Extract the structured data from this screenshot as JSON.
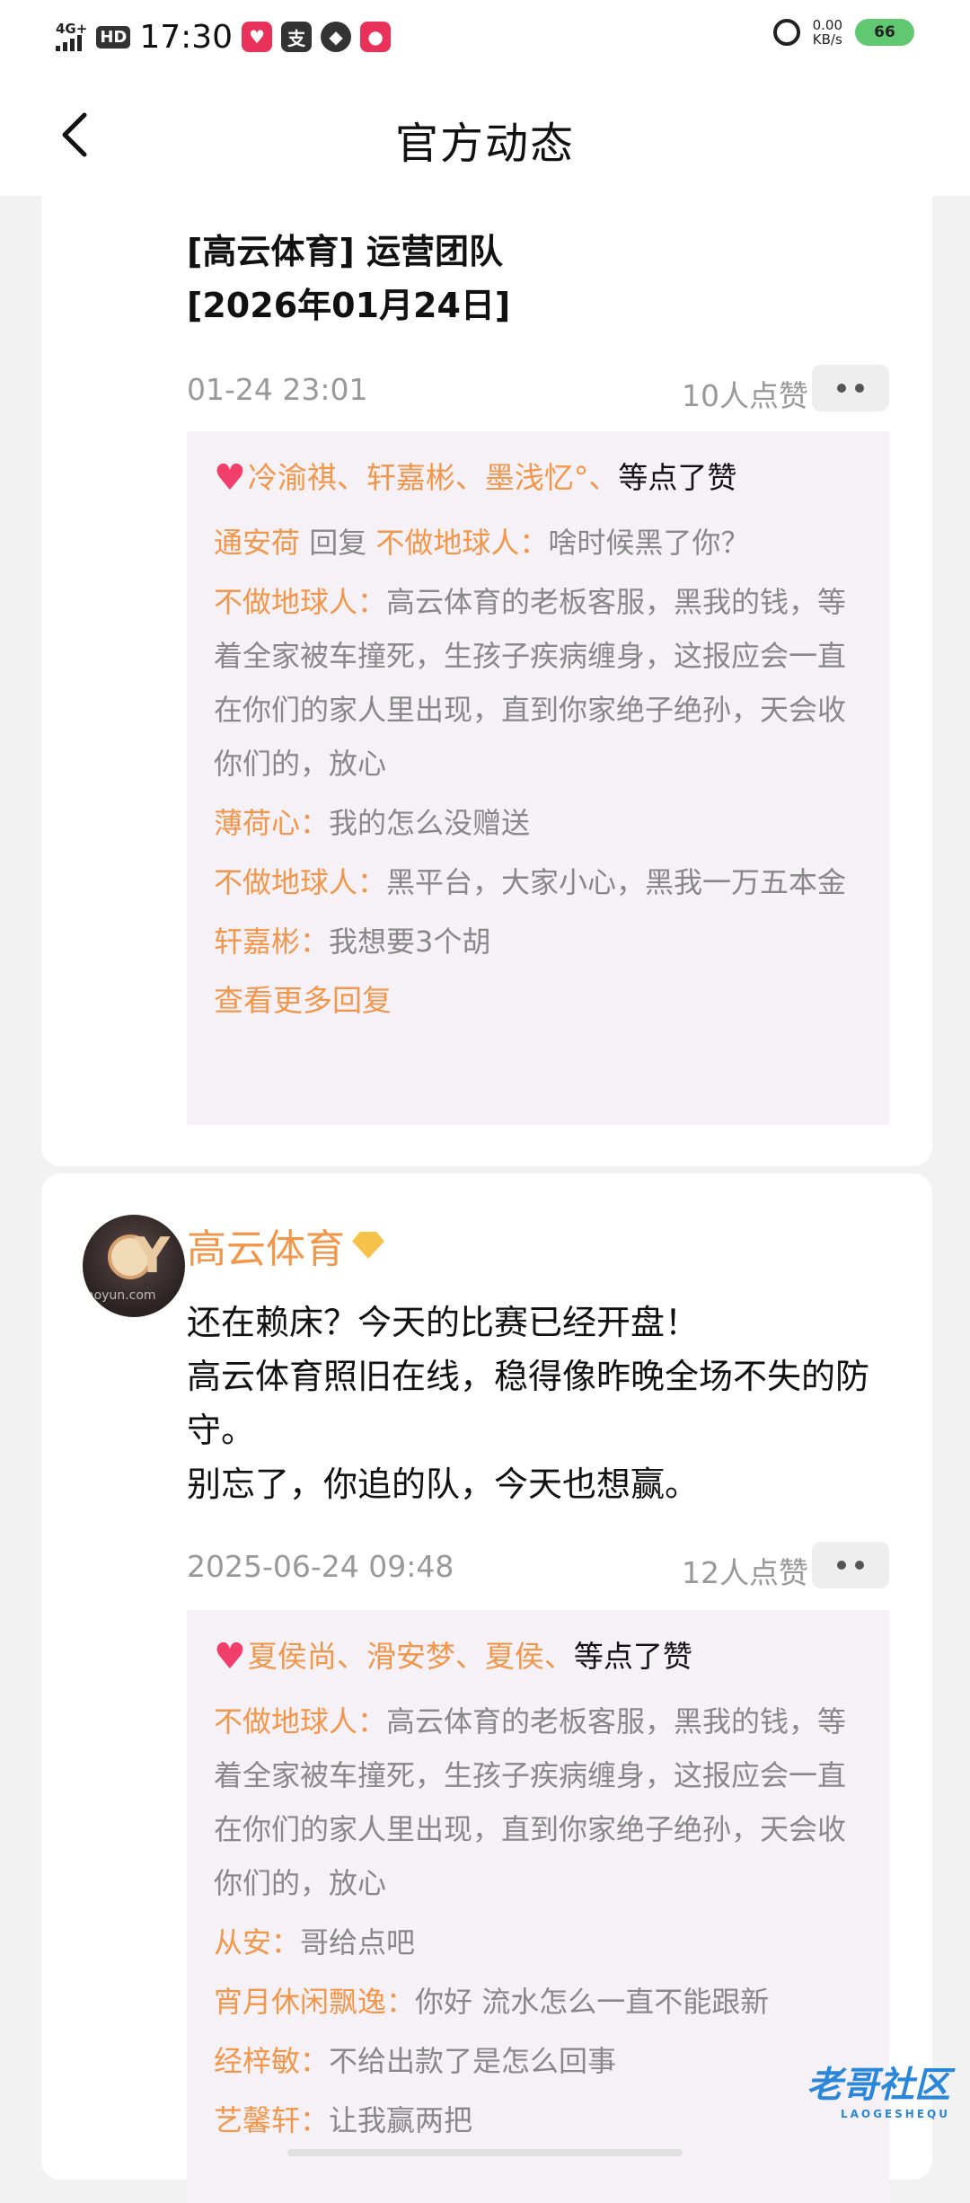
{
  "status_bar": {
    "network": "4G+",
    "hd": "HD",
    "time": "17:30",
    "net_speed_value": "0.00",
    "net_speed_unit": "KB/s",
    "battery": "66",
    "app_icons": [
      "app-icon-red-1",
      "alipay-icon",
      "qq-icon",
      "app-icon-red-2"
    ]
  },
  "header": {
    "title": "官方动态"
  },
  "posts": [
    {
      "text_lines": [
        "[高云体育] 运营团队",
        "[2026年01月24日]"
      ],
      "date": "01-24 23:01",
      "likes": "10人点赞",
      "likers": "冷渝祺、轩嘉彬、墨浅忆°、",
      "likers_suffix": "等点了赞",
      "comments": [
        {
          "author": "通安荷",
          "reply_word": " 回复 ",
          "reply_to": "不做地球人：",
          "text": "啥时候黑了你？"
        },
        {
          "author": "不做地球人：",
          "text": "高云体育的老板客服，黑我的钱，等着全家被车撞死，生孩子疾病缠身，这报应会一直在你们的家人里出现，直到你家绝子绝孙，天会收你们的，放心"
        },
        {
          "author": "薄荷心：",
          "text": "我的怎么没赠送"
        },
        {
          "author": "不做地球人：",
          "text": "黑平台，大家小心，黑我一万五本金"
        },
        {
          "author": "轩嘉彬：",
          "text": "我想要3个胡"
        }
      ],
      "more_replies": "查看更多回复"
    },
    {
      "author_name": "高云体育",
      "avatar_text": "aoyun.com",
      "text_lines": [
        "还在赖床？今天的比赛已经开盘！",
        "高云体育照旧在线，稳得像昨晚全场不失的防守。",
        "别忘了，你追的队，今天也想赢。"
      ],
      "date": "2025-06-24 09:48",
      "likes": "12人点赞",
      "likers": "夏侯尚、滑安梦、夏侯、",
      "likers_suffix": "等点了赞",
      "comments": [
        {
          "author": "不做地球人：",
          "text": "高云体育的老板客服，黑我的钱，等着全家被车撞死，生孩子疾病缠身，这报应会一直在你们的家人里出现，直到你家绝子绝孙，天会收你们的，放心"
        },
        {
          "author": "从安：",
          "text": "哥给点吧"
        },
        {
          "author": "宵月休闲飘逸：",
          "text": "你好 流水怎么一直不能跟新"
        },
        {
          "author": "经梓敏：",
          "text": "不给出款了是怎么回事"
        },
        {
          "author": "艺馨轩：",
          "text": "让我赢两把"
        }
      ]
    }
  ],
  "watermark": {
    "text": "老哥社区",
    "sub": "LAOGESHEQU"
  }
}
